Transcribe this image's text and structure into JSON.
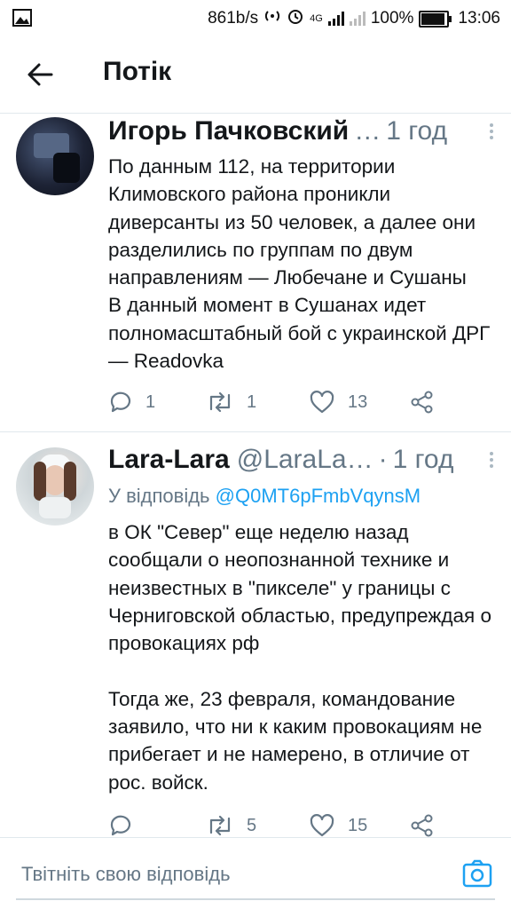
{
  "status_bar": {
    "speed": "861b/s",
    "network": "4G",
    "battery": "100%",
    "time": "13:06"
  },
  "header": {
    "title": "Потік"
  },
  "tweets": [
    {
      "name": "Игорь Пачковский",
      "handle": "",
      "time": "1 год",
      "reply_to_prefix": "",
      "reply_to_handle": "",
      "text": "По данным 112, на территории Климовского района проникли диверсанты из 50 человек, а далее они разделились по группам по двум направлениям — Любечане и Сушаны\nВ данный момент в Сушанах идет полномасштабный бой с украинской ДРГ — Readovka",
      "replies": "1",
      "retweets": "1",
      "likes": "13"
    },
    {
      "name": "Lara-Lara",
      "handle": "@LaraLa…",
      "time": "1 год",
      "reply_to_prefix": "У відповідь",
      "reply_to_handle": "@Q0MT6pFmbVqynsM",
      "text": "в ОК \"Север\" еще неделю назад сообщали о неопознанной технике и неизвестных в \"пикселе\" у границы с Черниговской областью, предупреждая о провокациях рф\n\nТогда же, 23 февраля, командование заявило, что ни к каким провокациям не прибегает и не намерено, в отличие от рос. войск.",
      "replies": "",
      "retweets": "5",
      "likes": "15"
    }
  ],
  "reply_bar": {
    "placeholder": "Твітніть свою відповідь"
  },
  "colors": {
    "accent": "#1da1f2",
    "secondary_text": "#657786",
    "divider": "#e1e8ed"
  },
  "icons": [
    "back-arrow-icon",
    "more-icon",
    "reply-icon",
    "retweet-icon",
    "like-icon",
    "share-icon",
    "camera-icon"
  ]
}
